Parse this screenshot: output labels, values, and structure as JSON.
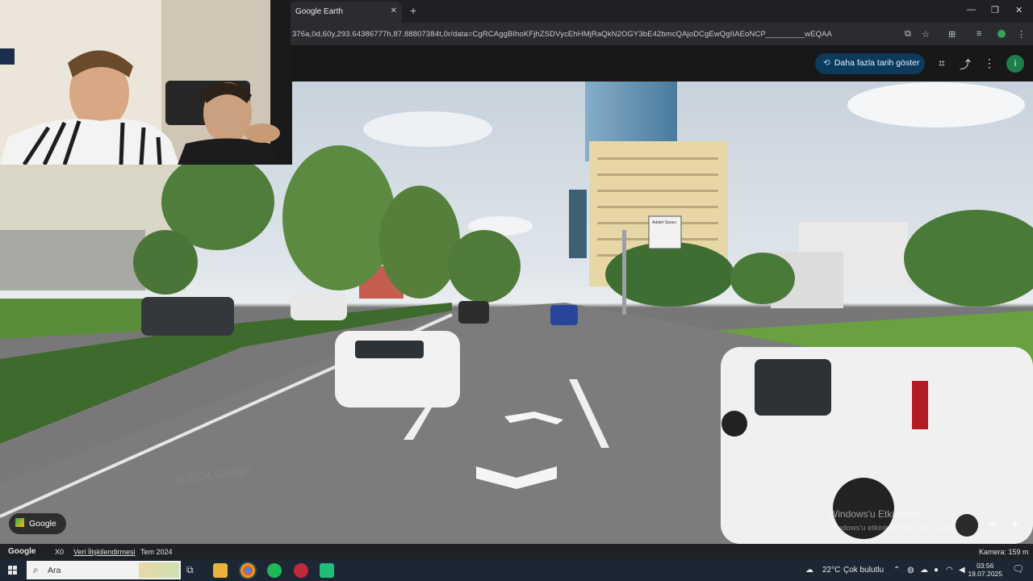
{
  "browser": {
    "tab_title": "Google Earth",
    "tab_close": "✕",
    "new_tab": "+",
    "minimize": "—",
    "restore": "❐",
    "close": "✕",
    "url": "376a,0d,60y,293.64386777h,87.88807384t,0r/data=CgRCAggBIhoKFjhZSDVycEhHMjRaQkN2OGY3bE42bmcQAjoDCgEwQgIIAEoNCP_________wEQAA",
    "icons": [
      "cast-icon",
      "star-icon",
      "extensions-icon",
      "media-icon",
      "menu-icon"
    ]
  },
  "earth": {
    "history_button": "Daha fazla tarih göster",
    "avatar_letter": "i",
    "google_chip": "Google",
    "watermark_line1": "Windows'u Etkinleştir",
    "watermark_line2": "Windows'u etkinleştirmek için Ayarlar'a gidin.",
    "zoom_out": "−",
    "zoom_in": "+",
    "street_sign": "Adalet Sarayı",
    "scene_copyright": "© 2024 Google"
  },
  "footer": {
    "google": "Google",
    "scale": "X0",
    "data_attr": "Veri İlişkilendirmesi",
    "date": "Tem 2024",
    "camera": "Kamera: 159 m"
  },
  "taskbar": {
    "search_placeholder": "Ara",
    "weather_temp": "22°C",
    "weather_text": "Çok bulutlu",
    "time": "03:56",
    "date": "19.07.2025",
    "accent": "#1c2733"
  }
}
